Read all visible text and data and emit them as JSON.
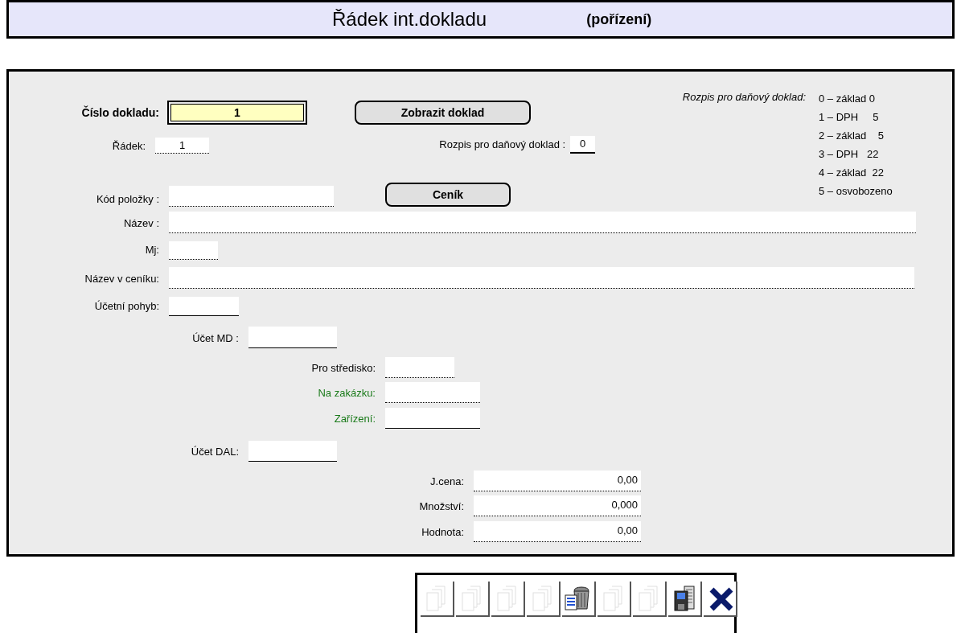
{
  "header": {
    "title": "Řádek int.dokladu",
    "subtitle": "(pořízení)"
  },
  "document_number": {
    "label": "Číslo dokladu:",
    "value": "1"
  },
  "show_document_button": "Zobrazit doklad",
  "line": {
    "label": "Řádek:",
    "value": "1"
  },
  "tax_split": {
    "label": "Rozpis pro daňový doklad :",
    "value": "0"
  },
  "tax_legend": {
    "title": "Rozpis pro daňový doklad:",
    "items": [
      "0 – základ 0",
      "1 – DPH     5",
      "2 – základ    5",
      "3 – DPH   22",
      "4 – základ  22",
      "5 – osvobozeno"
    ]
  },
  "item_code": {
    "label": "Kód položky :"
  },
  "price_list_button": "Ceník",
  "fields": [
    {
      "label": "Název :",
      "kind": "dotted",
      "highlighted": false
    },
    {
      "label": "Mj:",
      "kind": "dotted",
      "highlighted": false
    },
    {
      "label": "Název v ceníku:",
      "kind": "dotted",
      "highlighted": false
    },
    {
      "label": "Účetní pohyb:",
      "kind": "solid",
      "highlighted": false
    },
    {
      "label": "Účet MD :",
      "kind": "solid",
      "highlighted": false
    },
    {
      "label": "Pro středisko:",
      "kind": "dotted",
      "highlighted": false
    },
    {
      "label": "Na zakázku:",
      "kind": "dotted",
      "highlighted": true
    },
    {
      "label": "Zařízení:",
      "kind": "solid",
      "highlighted": true
    },
    {
      "label": "Účet DAL:",
      "kind": "solid",
      "highlighted": false
    },
    {
      "label": "J.cena:",
      "kind": "dotted",
      "highlighted": false,
      "value": "0,00"
    },
    {
      "label": "Množství:",
      "kind": "dotted",
      "highlighted": false,
      "value": "0,000"
    },
    {
      "label": "Hodnota:",
      "kind": "dotted",
      "highlighted": false,
      "value": "0,00"
    }
  ],
  "toolbar": [
    {
      "kind": "pages",
      "disabled": true
    },
    {
      "kind": "pages",
      "disabled": true
    },
    {
      "kind": "pages",
      "disabled": true
    },
    {
      "kind": "pages",
      "disabled": true
    },
    {
      "kind": "trash",
      "disabled": false
    },
    {
      "kind": "pages",
      "disabled": true
    },
    {
      "kind": "pages",
      "disabled": true
    },
    {
      "kind": "save",
      "disabled": false
    },
    {
      "kind": "close",
      "disabled": false
    }
  ]
}
